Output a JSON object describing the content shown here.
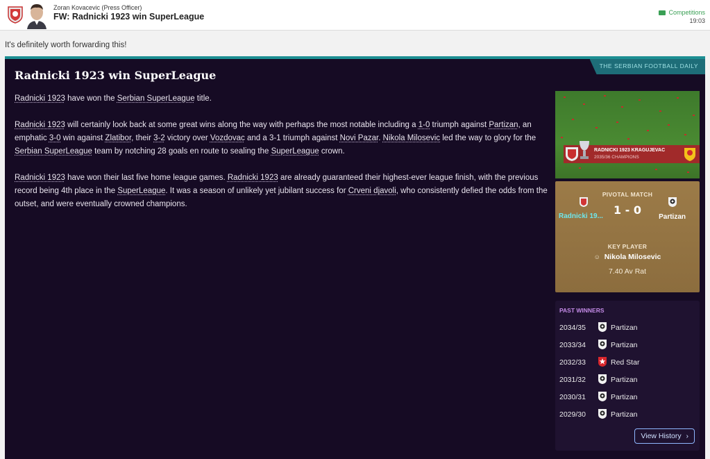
{
  "header": {
    "sender": "Zoran Kovacevic  (Press Officer)",
    "subject": "FW: Radnicki 1923 win SuperLeague",
    "category": "Competitions",
    "time": "19:03",
    "category_color": "#3aa055"
  },
  "message": "It's definitely worth forwarding this!",
  "article": {
    "source": "THE SERBIAN FOOTBALL DAILY",
    "headline": "Radnicki 1923 win SuperLeague",
    "p1": {
      "a": "Radnicki 1923",
      "b": " have won the ",
      "c": "Serbian SuperLeague",
      "d": " title."
    },
    "p2": {
      "a": "Radnicki 1923",
      "b": " will certainly look back at some great wins along the way with perhaps the most notable including a ",
      "c": "1-0",
      "d": " triumph against ",
      "e": "Partizan",
      "f": ", an emphatic ",
      "g": "3-0",
      "h": " win against ",
      "i": "Zlatibor",
      "j": ", their ",
      "k": "3-2",
      "l": " victory over ",
      "m": "Vozdovac",
      "n": " and a 3-1 triumph against ",
      "o": "Novi Pazar",
      "p": ". ",
      "q": "Nikola Milosevic",
      "r": " led the way to glory for the ",
      "s": "Serbian SuperLeague",
      "t": " team by notching 28 goals en route to sealing the ",
      "u": "SuperLeague",
      "v": " crown."
    },
    "p3": {
      "a": "Radnicki 1923",
      "b": " have won their last five home league games. ",
      "c": "Radnicki 1923",
      "d": " are already guaranteed their highest-ever league finish, with the previous record being 4th place in the ",
      "e": "SuperLeague",
      "f": ". It was a season of unlikely yet jubilant success for ",
      "g": "Crveni djavoli",
      "h": ", who consistently defied the odds from the outset, and were eventually crowned champions."
    }
  },
  "photo": {
    "banner_title": "RADNICKI 1923 KRAGUJEVAC",
    "banner_sub": "2035/36 CHAMPIONS"
  },
  "pivotal_match": {
    "label": "PIVOTAL MATCH",
    "home": "Radnicki 19...",
    "away": "Partizan",
    "score": "1 - 0",
    "key_player_label": "KEY PLAYER",
    "key_player": "Nikola Milosevic",
    "rating": "7.40 Av Rat",
    "home_name_color": "#6ee6ec"
  },
  "past_winners": {
    "title": "PAST WINNERS",
    "rows": [
      {
        "season": "2034/35",
        "club": "Partizan",
        "badge": "partizan-badge-icon"
      },
      {
        "season": "2033/34",
        "club": "Partizan",
        "badge": "partizan-badge-icon"
      },
      {
        "season": "2032/33",
        "club": "Red Star",
        "badge": "red-star-badge-icon"
      },
      {
        "season": "2031/32",
        "club": "Partizan",
        "badge": "partizan-badge-icon"
      },
      {
        "season": "2030/31",
        "club": "Partizan",
        "badge": "partizan-badge-icon"
      },
      {
        "season": "2029/30",
        "club": "Partizan",
        "badge": "partizan-badge-icon"
      }
    ],
    "view_history": "View History",
    "title_color": "#c38ae6"
  },
  "colors": {
    "article_bg": "#160b24",
    "accent_teal": "#1d8f93",
    "gold_panel": "#9c7b48"
  }
}
